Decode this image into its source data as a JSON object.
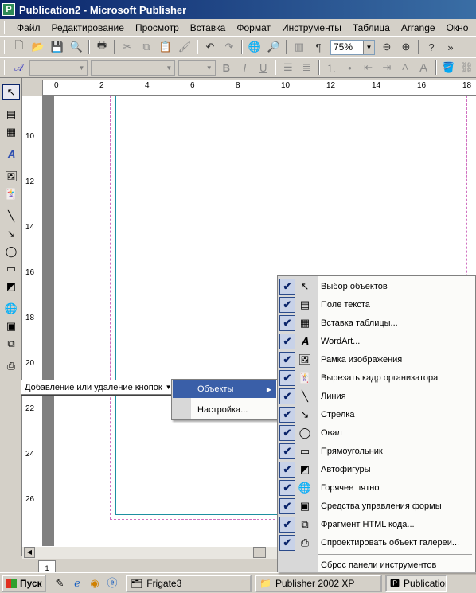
{
  "window": {
    "title": "Publication2 - Microsoft Publisher"
  },
  "menubar": {
    "items": [
      "Файл",
      "Редактирование",
      "Просмотр",
      "Вставка",
      "Формат",
      "Инструменты",
      "Таблица",
      "Arrange",
      "Окно"
    ]
  },
  "toolbar": {
    "zoom_value": "75%"
  },
  "rulers": {
    "horizontal": [
      "0",
      "2",
      "4",
      "6",
      "8",
      "10",
      "12",
      "14",
      "16",
      "18"
    ],
    "vertical": [
      "10",
      "12",
      "14",
      "16",
      "18",
      "20",
      "22",
      "24",
      "26"
    ]
  },
  "context_tip": {
    "label": "Добавление или удаление кнопок"
  },
  "submenu": {
    "items": [
      "Объекты",
      "Настройка..."
    ]
  },
  "objects_menu": {
    "items": [
      {
        "label": "Выбор объектов",
        "icon": "pointer-icon"
      },
      {
        "label": "Поле текста",
        "icon": "text-box-icon"
      },
      {
        "label": "Вставка таблицы...",
        "icon": "table-icon"
      },
      {
        "label": "WordArt...",
        "icon": "wordart-icon"
      },
      {
        "label": "Рамка изображения",
        "icon": "picture-frame-icon"
      },
      {
        "label": "Вырезать кадр организатора",
        "icon": "clip-organizer-icon"
      },
      {
        "label": "Линия",
        "icon": "line-icon"
      },
      {
        "label": "Стрелка",
        "icon": "arrow-icon"
      },
      {
        "label": "Овал",
        "icon": "oval-icon"
      },
      {
        "label": "Прямоугольник",
        "icon": "rectangle-icon"
      },
      {
        "label": "Автофигуры",
        "icon": "autoshapes-icon"
      },
      {
        "label": "Горячее пятно",
        "icon": "hotspot-icon"
      },
      {
        "label": "Средства управления формы",
        "icon": "form-controls-icon"
      },
      {
        "label": "Фрагмент HTML кода...",
        "icon": "html-fragment-icon"
      },
      {
        "label": "Спроектировать объект галереи...",
        "icon": "design-gallery-icon"
      }
    ],
    "reset_label": "Сброс панели инструментов"
  },
  "page_nav": {
    "current_page": "1"
  },
  "taskbar": {
    "start_label": "Пуск",
    "tasks": [
      "Frigate3",
      "Publisher 2002 XP",
      "Publication"
    ]
  }
}
